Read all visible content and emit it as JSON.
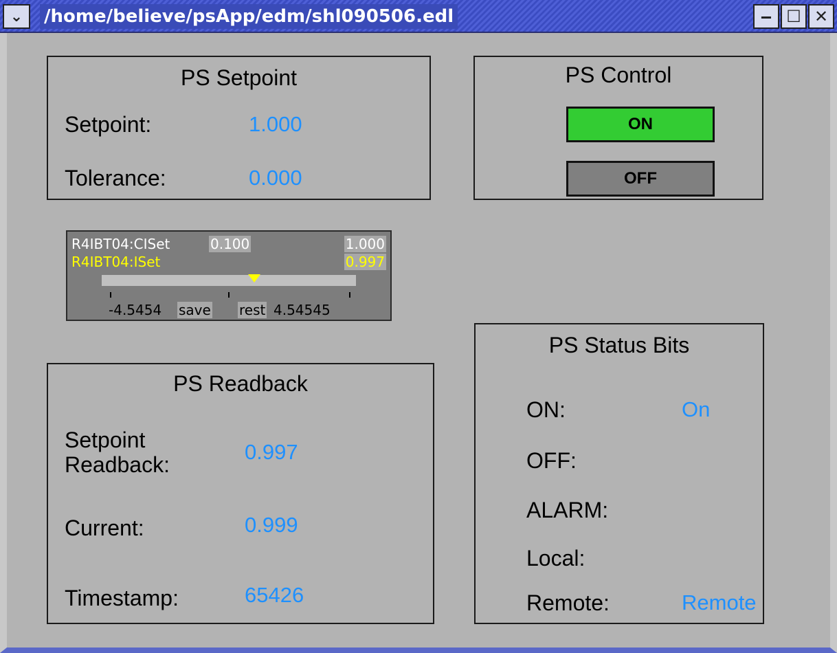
{
  "window": {
    "title": "/home/believe/psApp/edm/shl090506.edl",
    "menu_glyph": "⌄",
    "minimize_glyph": "‒",
    "maximize_glyph": "☐",
    "close_glyph": "✕"
  },
  "setpoint_panel": {
    "title": "PS Setpoint",
    "setpoint_label": "Setpoint:",
    "setpoint_value": "1.000",
    "tolerance_label": "Tolerance:",
    "tolerance_value": "0.000"
  },
  "control_panel": {
    "title": "PS Control",
    "on_label": "ON",
    "off_label": "OFF",
    "on_color": "#33cc33",
    "off_color": "#808080"
  },
  "slider": {
    "control_pv": "R4IBT04:CISet",
    "control_increment": "0.100",
    "control_value": "1.000",
    "readback_pv": "R4IBT04:ISet",
    "readback_value": "0.997",
    "min": "-4.5454",
    "max": "4.54545",
    "save_label": "save",
    "restore_label": "rest",
    "position_fraction": 0.6
  },
  "readback_panel": {
    "title": "PS Readback",
    "setpoint_readback_label_line1": "Setpoint",
    "setpoint_readback_label_line2": "Readback:",
    "setpoint_readback_value": "0.997",
    "current_label": "Current:",
    "current_value": "0.999",
    "timestamp_label": "Timestamp:",
    "timestamp_value": "65426"
  },
  "status_panel": {
    "title": "PS Status Bits",
    "on_label": "ON:",
    "on_value": "On",
    "off_label": "OFF:",
    "off_value": "",
    "alarm_label": "ALARM:",
    "alarm_value": "",
    "local_label": "Local:",
    "local_value": "",
    "remote_label": "Remote:",
    "remote_value": "Remote"
  }
}
